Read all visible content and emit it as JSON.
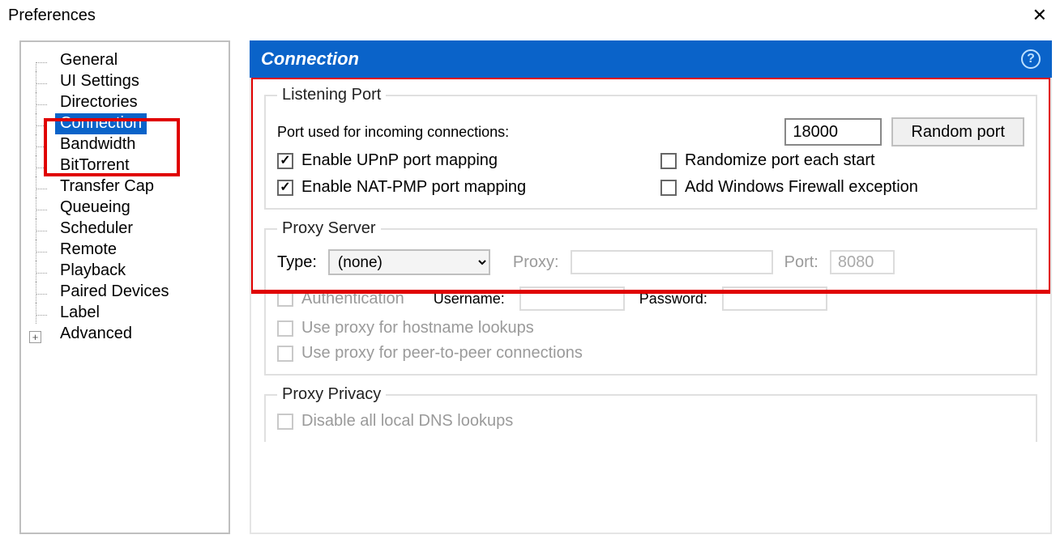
{
  "window": {
    "title": "Preferences"
  },
  "sidebar": {
    "items": {
      "general": "General",
      "ui": "UI Settings",
      "directories": "Directories",
      "connection": "Connection",
      "bandwidth": "Bandwidth",
      "bittorrent": "BitTorrent",
      "transfer_cap": "Transfer Cap",
      "queueing": "Queueing",
      "scheduler": "Scheduler",
      "remote": "Remote",
      "playback": "Playback",
      "paired_devices": "Paired Devices",
      "label": "Label",
      "advanced": "Advanced"
    },
    "expander_glyph": "+"
  },
  "panel": {
    "title": "Connection",
    "listening_port": {
      "legend": "Listening Port",
      "incoming_label": "Port used for incoming connections:",
      "port_value": "18000",
      "random_button": "Random port",
      "upnp": {
        "label": "Enable UPnP port mapping",
        "checked": true
      },
      "natpmp": {
        "label": "Enable NAT-PMP port mapping",
        "checked": true
      },
      "randomize": {
        "label": "Randomize port each start",
        "checked": false
      },
      "firewall": {
        "label": "Add Windows Firewall exception",
        "checked": false
      }
    },
    "proxy": {
      "legend": "Proxy Server",
      "type_label": "Type:",
      "type_value": "(none)",
      "proxy_label": "Proxy:",
      "proxy_value": "",
      "port_label": "Port:",
      "port_value": "8080",
      "auth": {
        "label": "Authentication"
      },
      "user_label": "Username:",
      "user_value": "",
      "pass_label": "Password:",
      "pass_value": "",
      "hostname": {
        "label": "Use proxy for hostname lookups"
      },
      "p2p": {
        "label": "Use proxy for peer-to-peer connections"
      }
    },
    "proxy_privacy": {
      "legend": "Proxy Privacy",
      "dns": {
        "label": "Disable all local DNS lookups"
      }
    }
  }
}
